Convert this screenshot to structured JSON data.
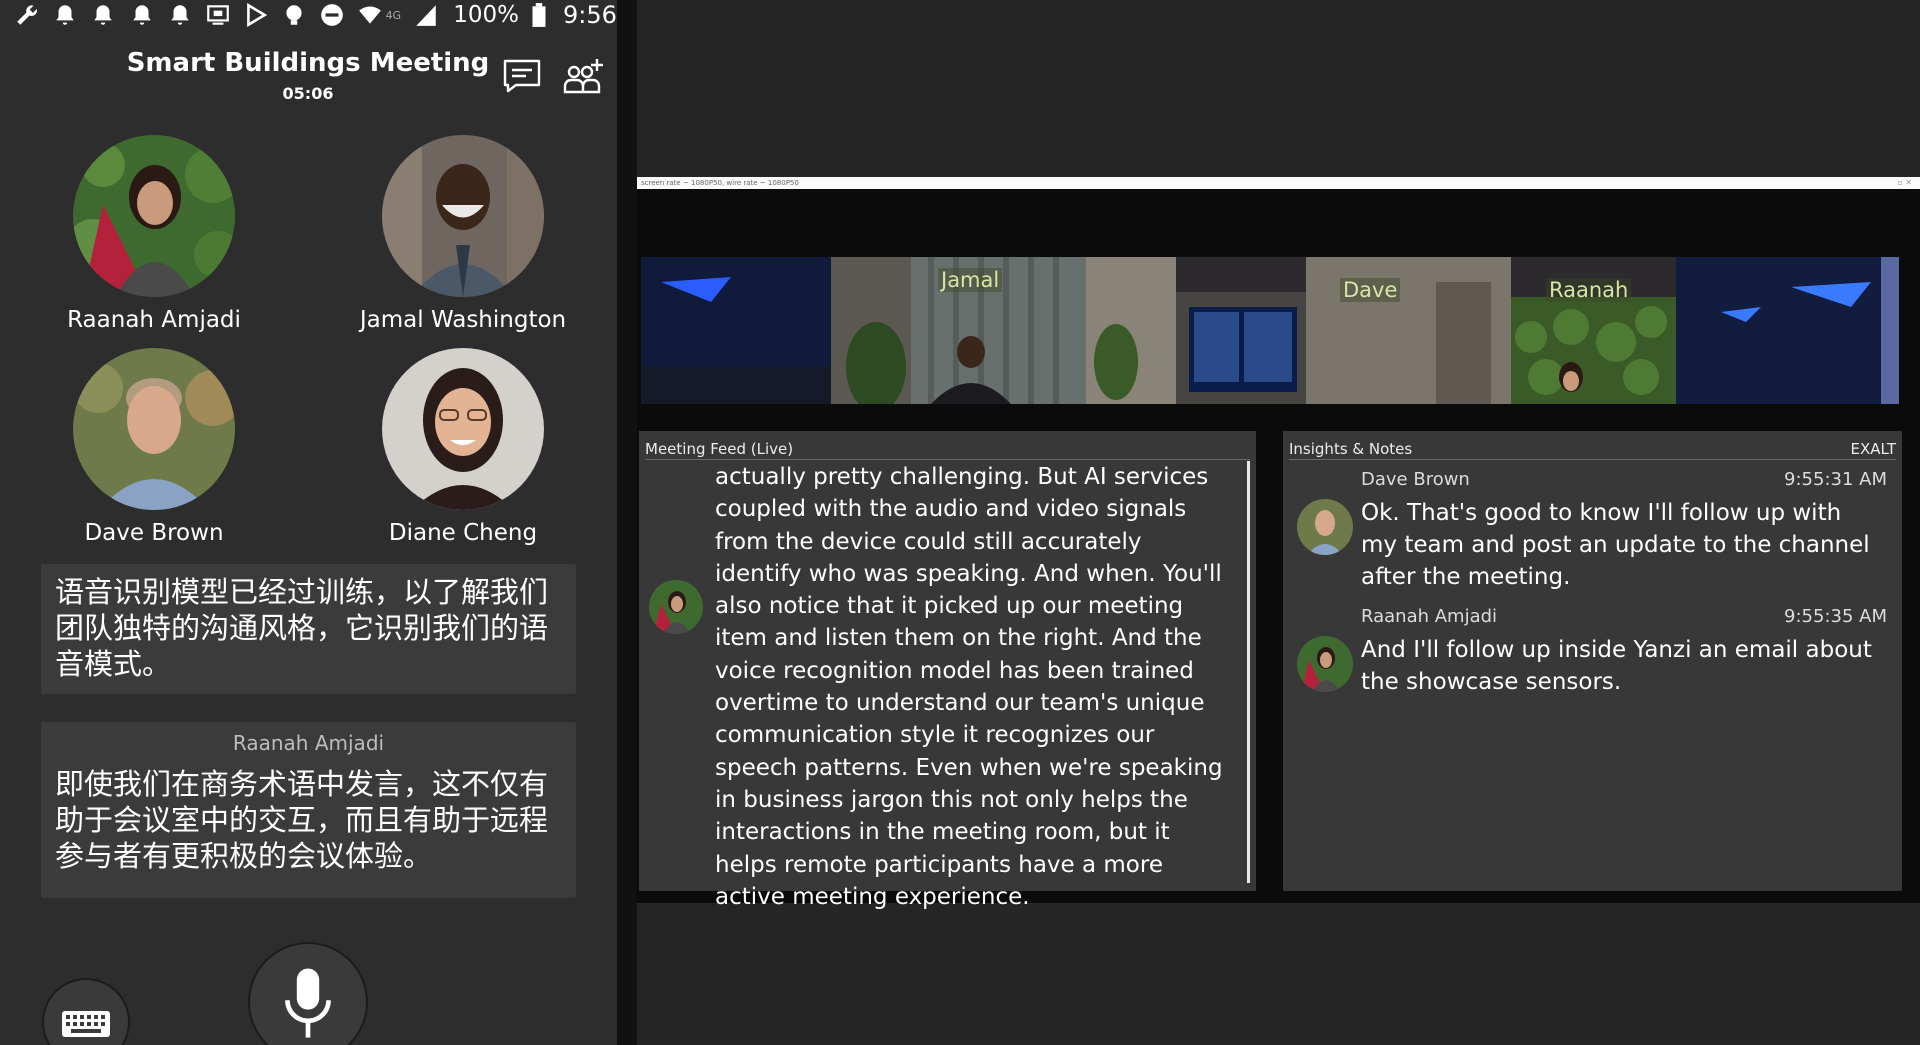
{
  "status_bar": {
    "battery_pct": "100%",
    "time": "9:56",
    "icons": [
      "wrench-icon",
      "bell-icon",
      "bell-icon",
      "bell-icon",
      "bell-icon",
      "cast-icon",
      "play-store-icon",
      "bulb-icon",
      "do-not-disturb-icon",
      "wifi-icon",
      "lte-label",
      "signal-icon",
      "battery-icon"
    ],
    "lte": "4G"
  },
  "meeting": {
    "title": "Smart Buildings Meeting",
    "timer": "05:06"
  },
  "participants": [
    {
      "name": "Raanah Amjadi"
    },
    {
      "name": "Jamal Washington"
    },
    {
      "name": "Dave Brown"
    },
    {
      "name": "Diane Cheng"
    }
  ],
  "captions": {
    "first": "语音识别模型已经过训练，以了解我们团队独特的沟通风格，它识别我们的语音模式。",
    "second_speaker": "Raanah Amjadi",
    "second": "即使我们在商务术语中发言，这不仅有助于会议室中的交互，而且有助于远程参与者有更积极的会议体验。"
  },
  "desktop": {
    "titlebar_text": "screen rate ~ 1080P50, wire rate ~ 1080P50",
    "room_labels": [
      "Jamal",
      "Dave",
      "Raanah"
    ],
    "feed": {
      "header": "Meeting Feed (Live)",
      "text": "actually pretty challenging. But AI services coupled with the audio and video signals from the device could still accurately identify who was speaking. And when. You'll also notice that it picked up our meeting item and listen them on the right. And the voice recognition model has been trained overtime to understand our team's unique communication style it recognizes our speech patterns. Even when we're speaking in business jargon this not only helps the interactions in the meeting room, but it helps remote participants have a more active meeting experience."
    },
    "insights": {
      "header": "Insights & Notes",
      "header_right": "EXALT",
      "notes": [
        {
          "name": "Dave Brown",
          "time": "9:55:31 AM",
          "text": "Ok. That's good to know I'll follow up with my team and post an update to the channel after the meeting."
        },
        {
          "name": "Raanah Amjadi",
          "time": "9:55:35 AM",
          "text": "And I'll follow up inside Yanzi an email about the showcase sensors."
        }
      ]
    }
  },
  "colors": {
    "phone_bg": "#2d2d2d",
    "caption_bg": "#3b3b3b",
    "panel_bg": "#383838",
    "label_green": "#d8e5a6"
  }
}
